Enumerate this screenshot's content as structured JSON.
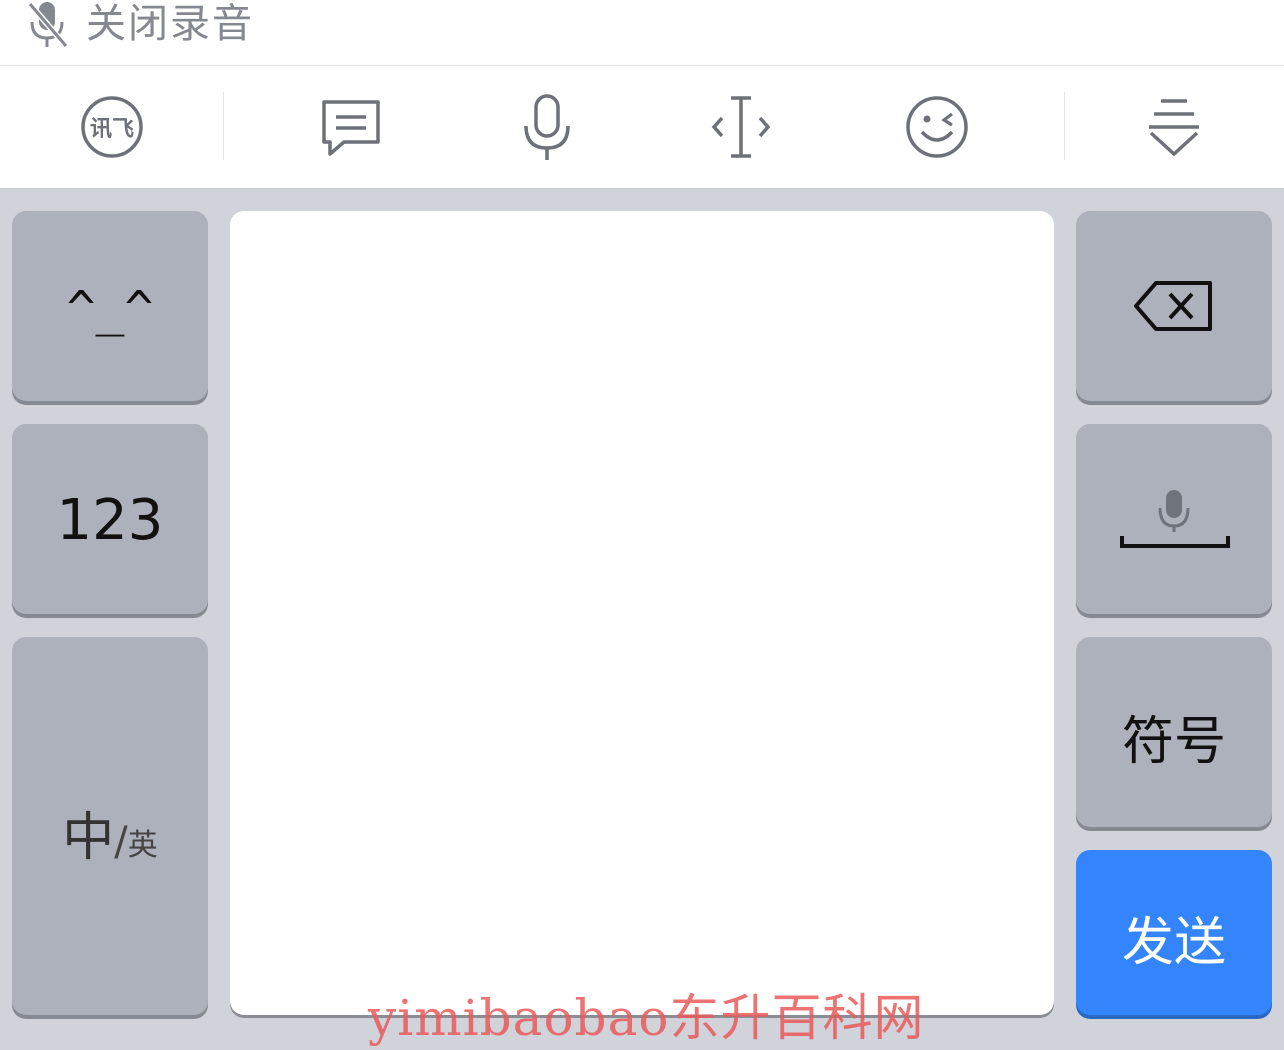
{
  "recording_bar": {
    "icon": "mic-off-icon",
    "label": "关闭录音"
  },
  "toolbar": {
    "items": [
      {
        "name": "iflytek-logo",
        "icon": "iflytek-logo-icon",
        "text": "讯飞"
      },
      {
        "name": "phrases",
        "icon": "message-icon"
      },
      {
        "name": "voice",
        "icon": "microphone-icon"
      },
      {
        "name": "cursor",
        "icon": "cursor-move-icon"
      },
      {
        "name": "emoji",
        "icon": "wink-smiley-icon"
      },
      {
        "name": "hide-keyboard",
        "icon": "collapse-keyboard-icon"
      }
    ]
  },
  "keys": {
    "emoticon": "^_^",
    "numbers": "123",
    "lang_main": "中",
    "lang_sep": "/",
    "lang_alt": "英",
    "backspace_icon": "backspace-icon",
    "space_icon": "space-mic-icon",
    "symbols": "符号",
    "send": "发送"
  },
  "colors": {
    "send": "#3485fc",
    "key": "#adb1bb",
    "keyboard_bg": "#d1d3db"
  },
  "watermark": "yimibaobao东升百科网"
}
